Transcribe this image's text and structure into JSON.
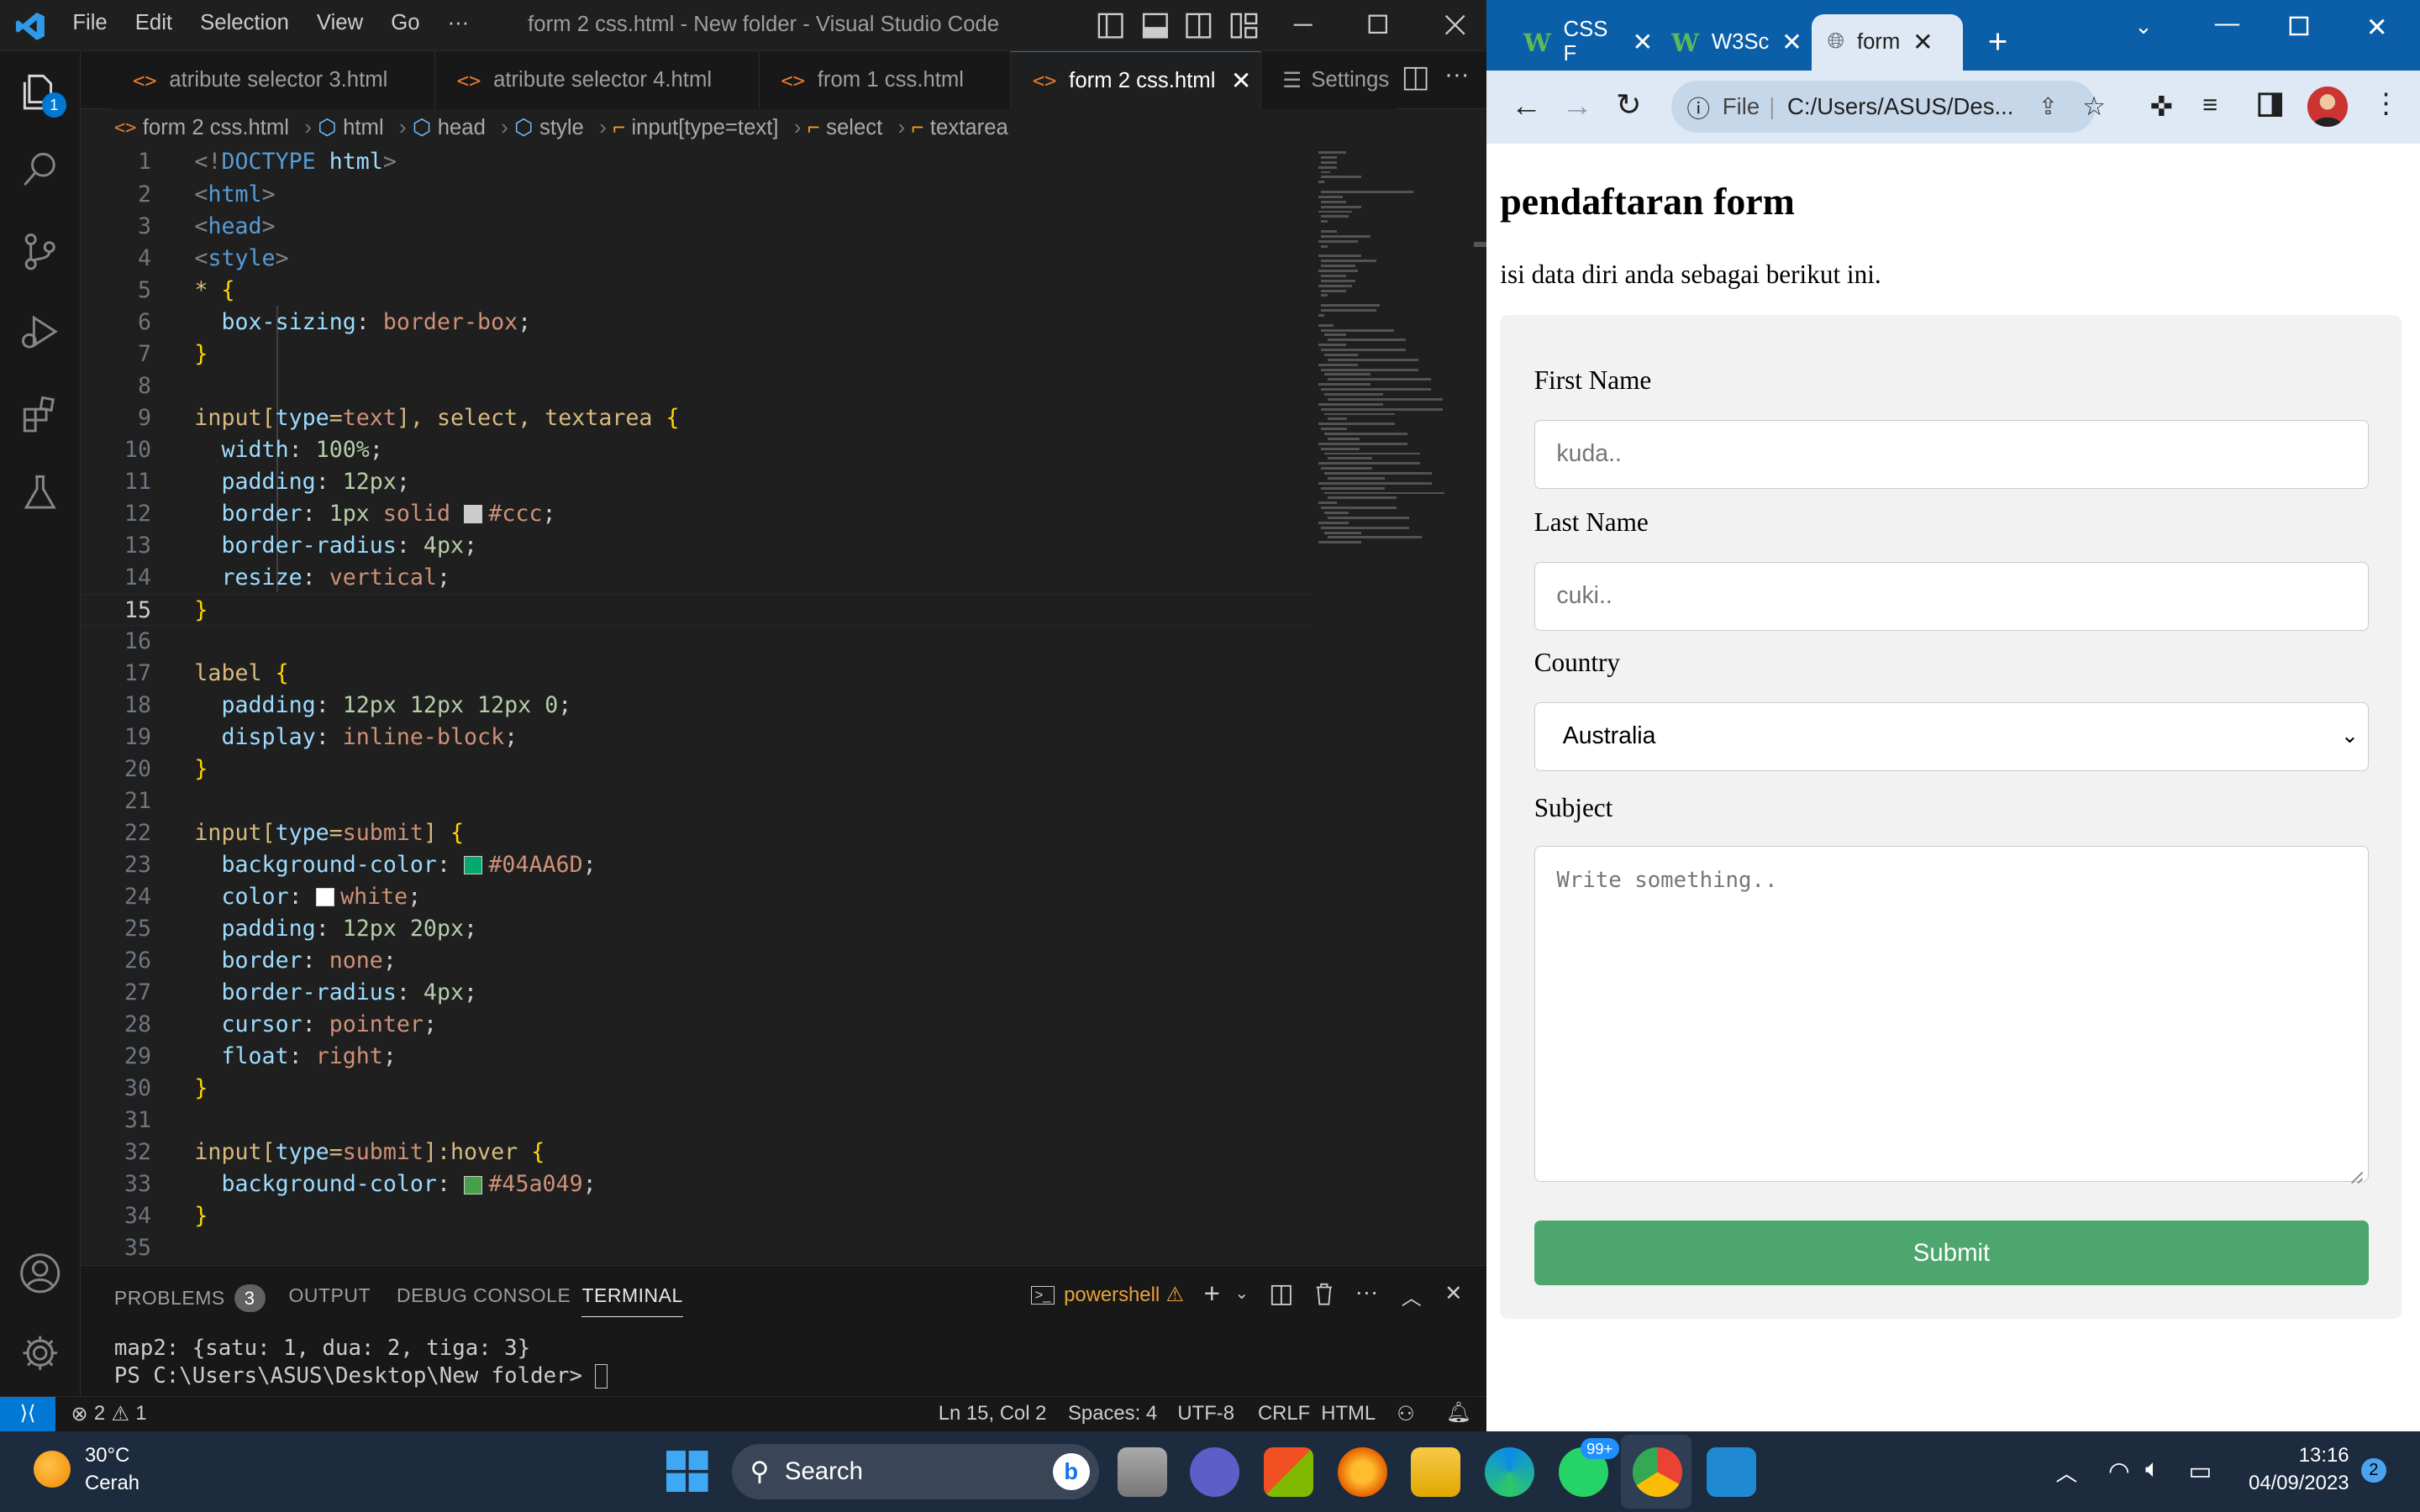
{
  "vscode": {
    "menu": [
      "File",
      "Edit",
      "Selection",
      "View",
      "Go",
      "···"
    ],
    "window_title": "form 2 css.html - New folder - Visual Studio Code",
    "explorer_badge": "1",
    "tabs": [
      "atribute selector 3.html",
      "atribute selector 4.html",
      "from 1 css.html",
      "form 2 css.html",
      "Settings"
    ],
    "breadcrumb": [
      "form 2 css.html",
      "html",
      "head",
      "style",
      "input[type=text]",
      "select",
      "textarea"
    ],
    "current_line": "15",
    "panel": {
      "tabs": [
        "PROBLEMS",
        "OUTPUT",
        "DEBUG CONSOLE",
        "TERMINAL"
      ],
      "problems_count": "3",
      "shell": "powershell",
      "terminal_lines": [
        "map2: {satu: 1, dua: 2, tiga: 3}",
        "PS C:\\Users\\ASUS\\Desktop\\New folder> "
      ]
    },
    "status": {
      "errors": "2",
      "warnings": "1",
      "position": "Ln 15, Col 2",
      "spaces": "Spaces: 4",
      "encoding": "UTF-8",
      "eol": "CRLF",
      "language": "HTML"
    },
    "colors": {
      "ccc": "#ccc",
      "green": "#04AA6D",
      "white": "#ffffff",
      "hover": "#45a049"
    }
  },
  "chrome": {
    "tabs": [
      "CSS F",
      "W3Sc",
      "form"
    ],
    "address_scheme": "File",
    "address": "C:/Users/ASUS/Des...",
    "page": {
      "heading": "pendaftaran form",
      "description": "isi data diri anda sebagai berikut ini.",
      "first_name_label": "First Name",
      "first_name_placeholder": "kuda..",
      "last_name_label": "Last Name",
      "last_name_placeholder": "cuki..",
      "country_label": "Country",
      "country_value": "Australia",
      "subject_label": "Subject",
      "subject_placeholder": "Write something..",
      "submit_label": "Submit"
    }
  },
  "taskbar": {
    "weather_temp": "30°C",
    "weather_desc": "Cerah",
    "search_label": "Search",
    "whatsapp_badge": "99+",
    "time": "13:16",
    "date": "04/09/2023",
    "notification_count": "2"
  }
}
